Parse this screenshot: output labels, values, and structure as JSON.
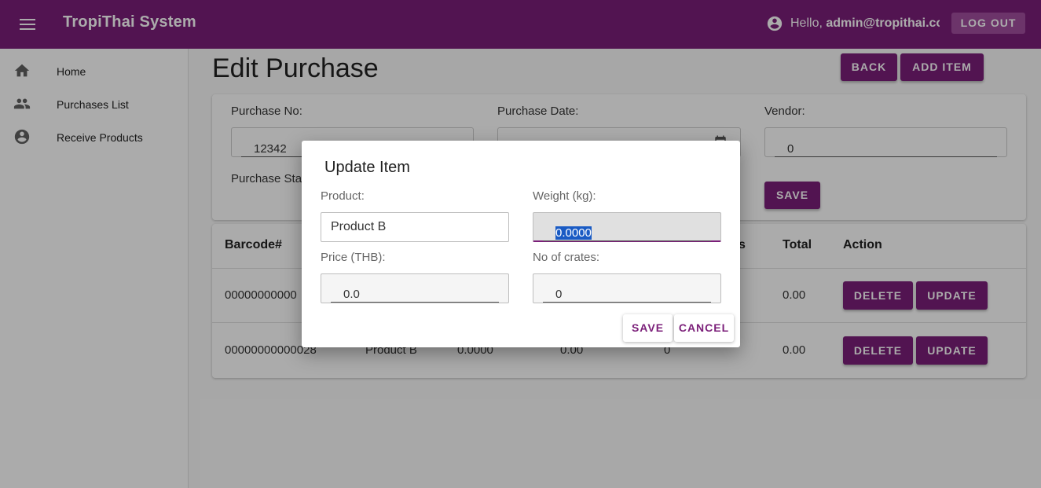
{
  "appbar": {
    "title": "TropiThai System",
    "greeting_prefix": "Hello, ",
    "user_email": "admin@tropithai.co",
    "greeting_suffix": "!",
    "logout_label": "LOG OUT"
  },
  "sidebar": {
    "items": [
      {
        "label": "Home",
        "icon": "home-icon"
      },
      {
        "label": "Purchases List",
        "icon": "people-icon"
      },
      {
        "label": "Receive Products",
        "icon": "account-icon"
      }
    ]
  },
  "page": {
    "title": "Edit Purchase",
    "back_label": "BACK",
    "add_item_label": "ADD ITEM"
  },
  "form": {
    "purchase_no_label": "Purchase No:",
    "purchase_no_value": "12342",
    "purchase_date_label": "Purchase Date:",
    "purchase_date_value": "",
    "vendor_label": "Vendor:",
    "vendor_value": "0",
    "purchase_status_label": "Purchase Sta",
    "save_label": "SAVE"
  },
  "table": {
    "headers": {
      "barcode": "Barcode#",
      "crates_partial": "s",
      "total": "Total",
      "action": "Action"
    },
    "rows": [
      {
        "barcode": "00000000000",
        "total": "0.00",
        "delete_label": "DELETE",
        "update_label": "UPDATE"
      },
      {
        "barcode": "00000000000028",
        "product": "Product B",
        "weight": "0.0000",
        "price": "0.00",
        "crates": "0",
        "total": "0.00",
        "delete_label": "DELETE",
        "update_label": "UPDATE"
      }
    ]
  },
  "dialog": {
    "title": "Update Item",
    "product_label": "Product:",
    "product_value": "Product B",
    "weight_label": "Weight (kg):",
    "weight_value": "0.0000",
    "price_label": "Price (THB):",
    "price_value": "0.0",
    "crates_label": "No of crates:",
    "crates_value": "0",
    "save_label": "SAVE",
    "cancel_label": "CANCEL"
  },
  "colors": {
    "primary": "#7b1f79",
    "selection": "#1a5bc4"
  }
}
